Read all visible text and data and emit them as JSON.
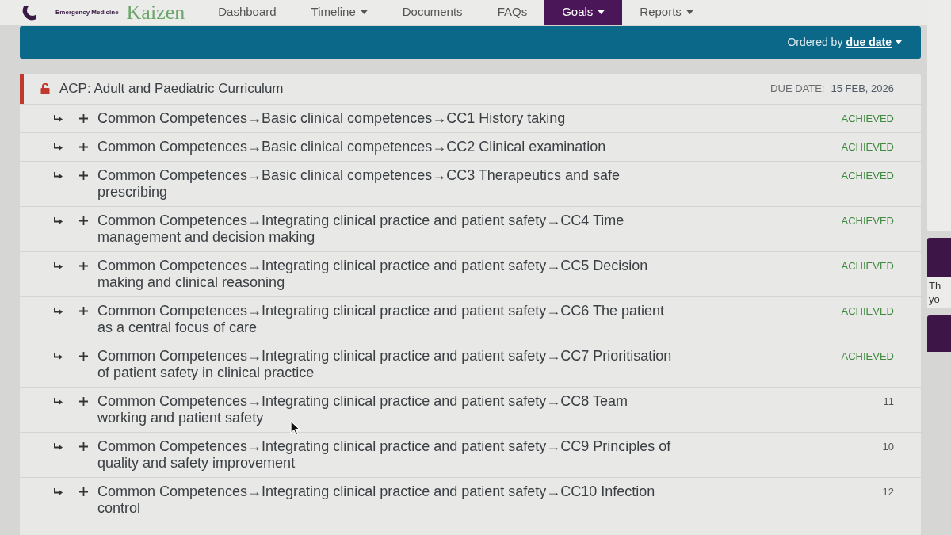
{
  "nav": {
    "logo_subtitle": "Emergency Medicine",
    "logo_name": "Kaizen",
    "items": [
      {
        "label": "Dashboard",
        "dropdown": false,
        "selected": false
      },
      {
        "label": "Timeline",
        "dropdown": true,
        "selected": false
      },
      {
        "label": "Documents",
        "dropdown": false,
        "selected": false
      },
      {
        "label": "FAQs",
        "dropdown": false,
        "selected": false
      },
      {
        "label": "Goals",
        "dropdown": true,
        "selected": true
      },
      {
        "label": "Reports",
        "dropdown": true,
        "selected": false
      }
    ]
  },
  "toolbar": {
    "order_label": "Ordered by",
    "order_value": "due date"
  },
  "goal": {
    "title": "ACP: Adult and Paediatric Curriculum",
    "due_label": "DUE DATE:",
    "due_value": "15 FEB, 2026",
    "items": [
      {
        "title": "Common Competences→Basic clinical competences→CC1 History taking",
        "kind": "achieved",
        "status": "ACHIEVED"
      },
      {
        "title": "Common Competences→Basic clinical competences→CC2 Clinical examination",
        "kind": "achieved",
        "status": "ACHIEVED"
      },
      {
        "title": "Common Competences→Basic clinical competences→CC3 Therapeutics and safe prescribing",
        "kind": "achieved",
        "status": "ACHIEVED"
      },
      {
        "title": "Common Competences→Integrating clinical practice and patient safety→CC4 Time management and decision making",
        "kind": "achieved",
        "status": "ACHIEVED"
      },
      {
        "title": "Common Competences→Integrating clinical practice and patient safety→CC5 Decision making and clinical reasoning",
        "kind": "achieved",
        "status": "ACHIEVED"
      },
      {
        "title": "Common Competences→Integrating clinical practice and patient safety→CC6 The patient as a central focus of care",
        "kind": "achieved",
        "status": "ACHIEVED"
      },
      {
        "title": "Common Competences→Integrating clinical practice and patient safety→CC7 Prioritisation of patient safety in clinical practice",
        "kind": "achieved",
        "status": "ACHIEVED"
      },
      {
        "title": "Common Competences→Integrating clinical practice and patient safety→CC8 Team working and patient safety",
        "kind": "count",
        "status": "11"
      },
      {
        "title": "Common Competences→Integrating clinical practice and patient safety→CC9 Principles of quality and safety improvement",
        "kind": "count",
        "status": "10"
      },
      {
        "title": "Common Competences→Integrating clinical practice and patient safety→CC10 Infection control",
        "kind": "count",
        "status": "12"
      }
    ]
  },
  "side_panel": {
    "lines": [
      "Th",
      "yo"
    ]
  }
}
